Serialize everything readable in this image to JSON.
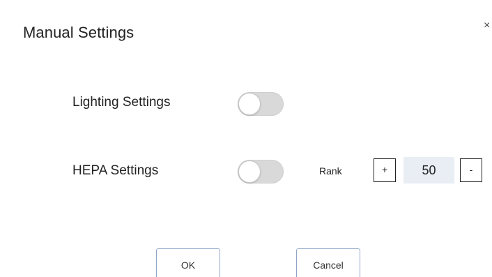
{
  "dialog": {
    "title": "Manual Settings",
    "close_glyph": "×"
  },
  "settings": {
    "lighting": {
      "label": "Lighting Settings",
      "enabled": false
    },
    "hepa": {
      "label": "HEPA Settings",
      "enabled": false,
      "rank_label": "Rank",
      "plus_label": "+",
      "rank_value": "50",
      "minus_label": "-"
    }
  },
  "actions": {
    "ok_label": "OK",
    "cancel_label": "Cancel"
  },
  "colors": {
    "toggle_off": "#d9d9d9",
    "rank_value_bg": "#e9eef5",
    "button_border": "#8fa6c9"
  }
}
